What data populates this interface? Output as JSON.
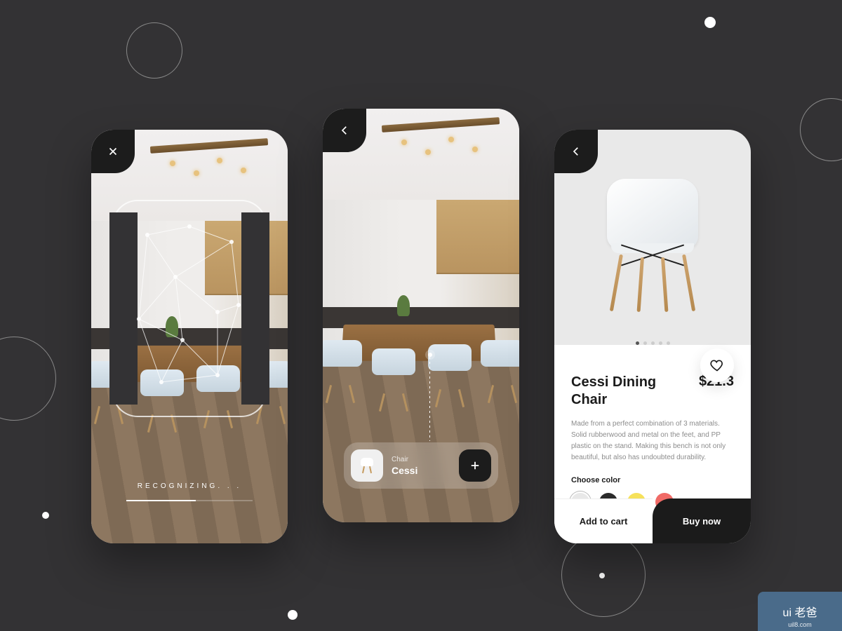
{
  "screen1": {
    "status": "RECOGNIZING. . ."
  },
  "screen2": {
    "result": {
      "category": "Chair",
      "name": "Cessi"
    }
  },
  "screen3": {
    "title": "Cessi Dining Chair",
    "price": "$21.3",
    "description": "Made from a perfect combination of 3 materials. Solid rubberwood and metal on the feet, and PP plastic on the stand. Making this bench is not only beautiful, but also has undoubted durability.",
    "choose_color_label": "Choose color",
    "colors": [
      "#e8e8e8",
      "#2b2b2b",
      "#f6e15a",
      "#f06a66"
    ],
    "selected_color_index": 0,
    "cta_cart": "Add to cart",
    "cta_buy": "Buy now"
  },
  "watermark": {
    "brand": "ui 老爸",
    "url": "uil8.com"
  }
}
